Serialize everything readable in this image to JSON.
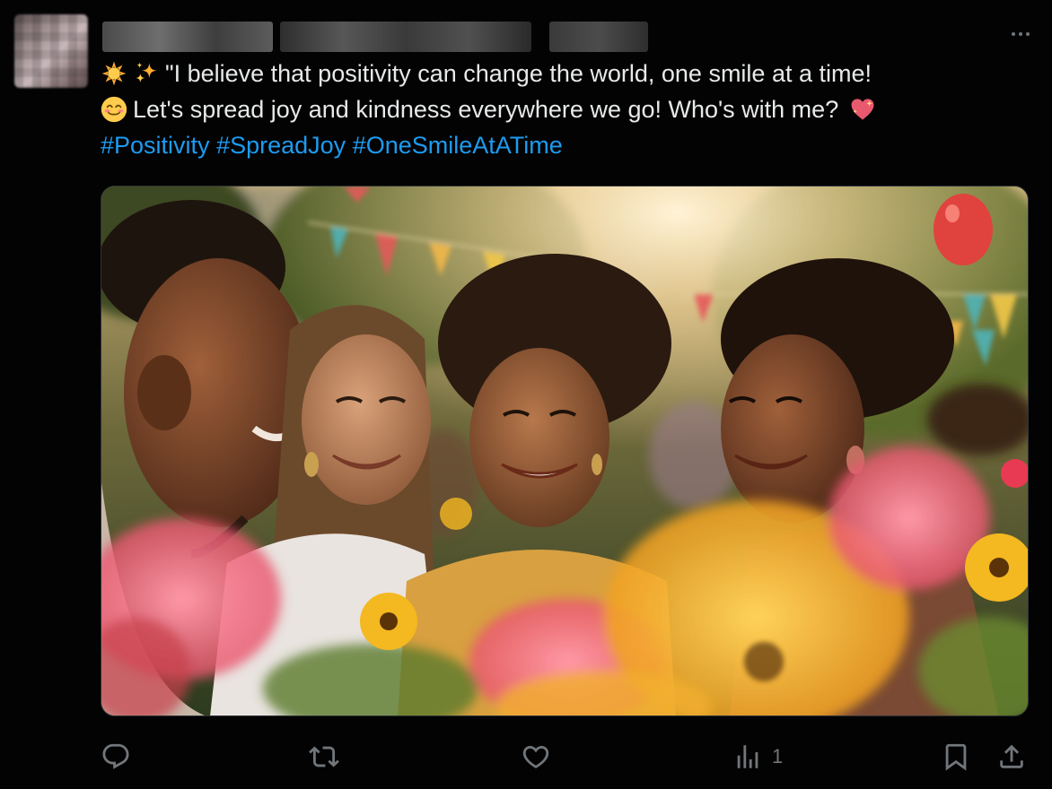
{
  "post": {
    "line1": "\"I believe that positivity can change the world, one smile at a time!",
    "line2": "Let's spread joy and kindness everywhere we go! Who's with me?",
    "hashtags": [
      "#Positivity",
      "#SpreadJoy",
      "#OneSmileAtATime"
    ],
    "emojis": [
      "sun-emoji",
      "sparkles-emoji",
      "smiling-face-emoji",
      "sparkling-heart-emoji"
    ]
  },
  "actions": {
    "reply_icon": "reply-icon",
    "repost_icon": "repost-icon",
    "like_icon": "heart-icon",
    "views_icon": "views-chart-icon",
    "views_count": "1",
    "bookmark_icon": "bookmark-icon",
    "share_icon": "share-icon"
  },
  "colors": {
    "background": "#030303",
    "text": "#e7e9ea",
    "hashtag": "#1d9bf0",
    "muted": "#71767b"
  }
}
